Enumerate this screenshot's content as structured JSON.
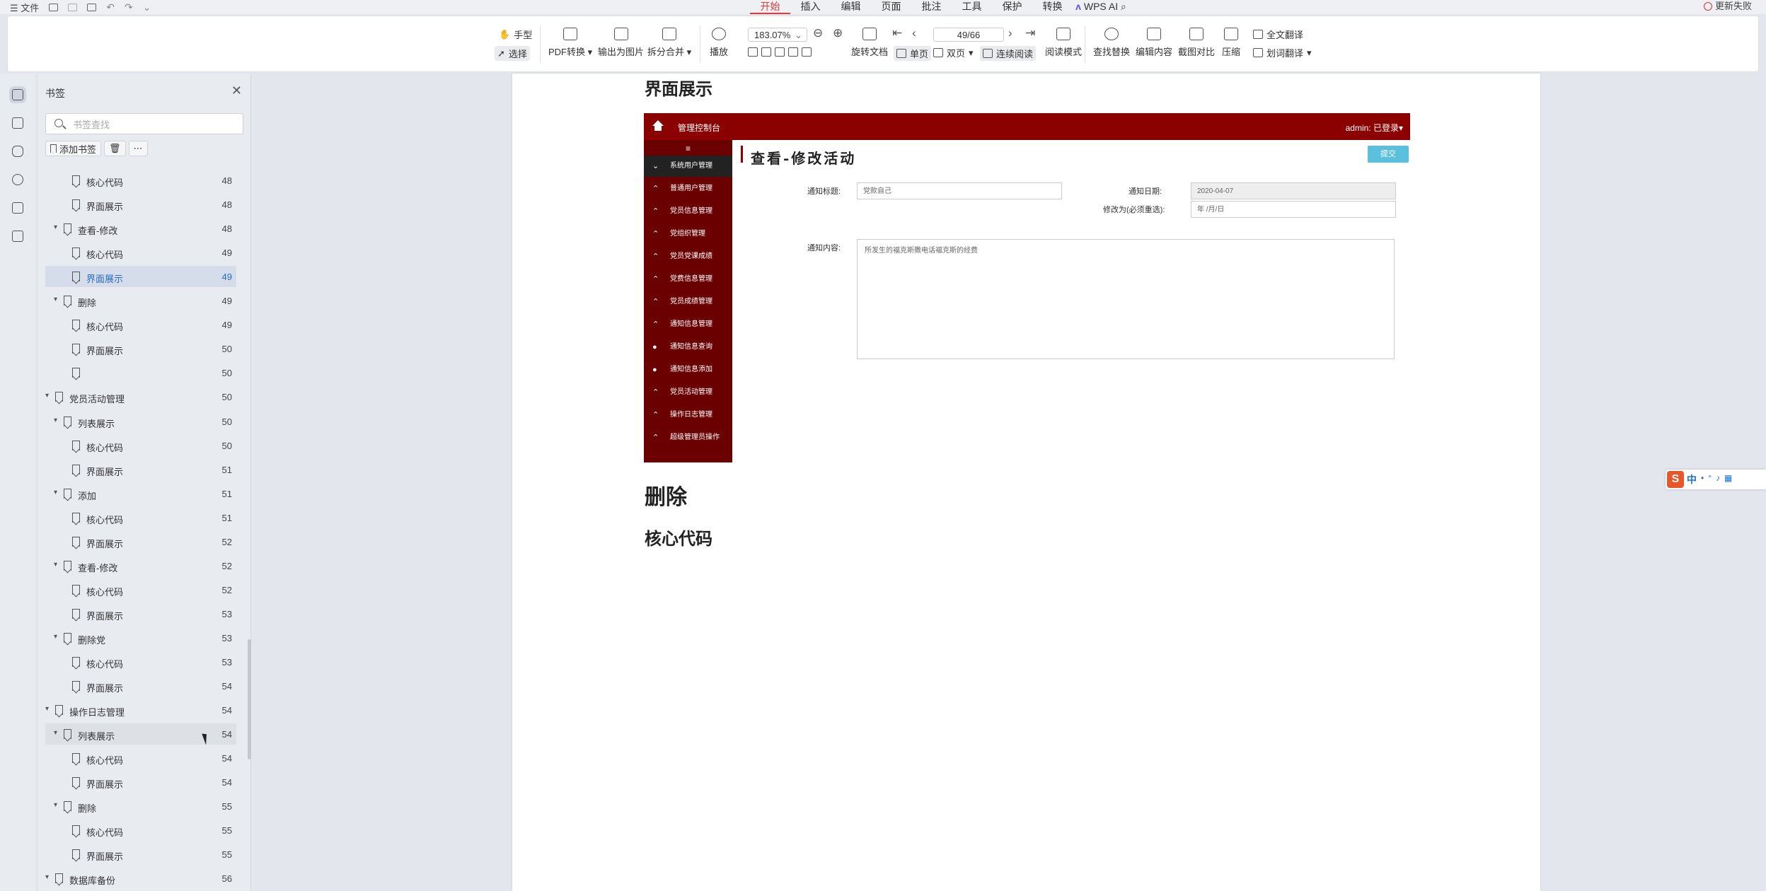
{
  "menubar": {
    "file_label": "文件",
    "tabs": [
      "开始",
      "插入",
      "编辑",
      "页面",
      "批注",
      "工具",
      "保护",
      "转换"
    ],
    "active_tab": 0,
    "wps_ai": "WPS AI",
    "update_failed": "更新失败"
  },
  "ribbon": {
    "hand": "手型",
    "select": "选择",
    "pdf_convert": "PDF转换",
    "export_image": "输出为图片",
    "split_merge": "拆分合并",
    "play": "播放",
    "zoom": "183.07%",
    "rotate": "旋转文档",
    "single_page": "单页",
    "double_page": "双页",
    "continuous": "连续阅读",
    "page_indicator": "49/66",
    "read_mode": "阅读模式",
    "find_replace": "查找替换",
    "edit_content": "编辑内容",
    "screenshot_compare": "截图对比",
    "compress": "压缩",
    "full_translate": "全文翻译",
    "word_translate": "划词翻译"
  },
  "bookmarks": {
    "title": "书签",
    "search_placeholder": "书签查找",
    "add_label": "添加书签",
    "items": [
      {
        "label": "核心代码",
        "page": "48"
      },
      {
        "label": "界面展示",
        "page": "48"
      },
      {
        "label": "查看-修改",
        "page": "48"
      },
      {
        "label": "核心代码",
        "page": "49"
      },
      {
        "label": "界面展示",
        "page": "49"
      },
      {
        "label": "删除",
        "page": "49"
      },
      {
        "label": "核心代码",
        "page": "49"
      },
      {
        "label": "界面展示",
        "page": "50"
      },
      {
        "label": "",
        "page": "50"
      },
      {
        "label": "党员活动管理",
        "page": "50"
      },
      {
        "label": "列表展示",
        "page": "50"
      },
      {
        "label": "核心代码",
        "page": "50"
      },
      {
        "label": "界面展示",
        "page": "51"
      },
      {
        "label": "添加",
        "page": "51"
      },
      {
        "label": "核心代码",
        "page": "51"
      },
      {
        "label": "界面展示",
        "page": "52"
      },
      {
        "label": "查看-修改",
        "page": "52"
      },
      {
        "label": "核心代码",
        "page": "52"
      },
      {
        "label": "界面展示",
        "page": "53"
      },
      {
        "label": "删除党",
        "page": "53"
      },
      {
        "label": "核心代码",
        "page": "53"
      },
      {
        "label": "界面展示",
        "page": "54"
      },
      {
        "label": "操作日志管理",
        "page": "54"
      },
      {
        "label": "列表展示",
        "page": "54"
      },
      {
        "label": "核心代码",
        "page": "54"
      },
      {
        "label": "界面展示",
        "page": "54"
      },
      {
        "label": "删除",
        "page": "55"
      },
      {
        "label": "核心代码",
        "page": "55"
      },
      {
        "label": "界面展示",
        "page": "55"
      },
      {
        "label": "数据库备份",
        "page": "56"
      }
    ]
  },
  "document": {
    "heading_ui": "界面展示",
    "heading_delete": "删除",
    "heading_core": "核心代码",
    "shot": {
      "app_title": "管理控制台",
      "admin": "admin: 已登录▾",
      "menu": [
        "系统用户管理",
        "普通用户管理",
        "党员信息管理",
        "党组织管理",
        "党员党课成绩",
        "党费信息管理",
        "党员成绩管理",
        "通知信息管理",
        "通知信息查询",
        "通知信息添加",
        "党员活动管理",
        "操作日志管理",
        "超级管理员操作"
      ],
      "page_title": "查看-修改活动",
      "submit": "提交",
      "title_label": "通知标题:",
      "title_value": "党款自己",
      "date_label": "通知日期:",
      "date_value": "2020-04-07",
      "modify_label": "修改为(必须重选):",
      "modify_placeholder": "年 /月/日",
      "content_label": "通知内容:",
      "content_value": "所发生的福克斯撒电话福克斯的经费"
    }
  },
  "ime": {
    "logo": "S",
    "lang": "中"
  }
}
